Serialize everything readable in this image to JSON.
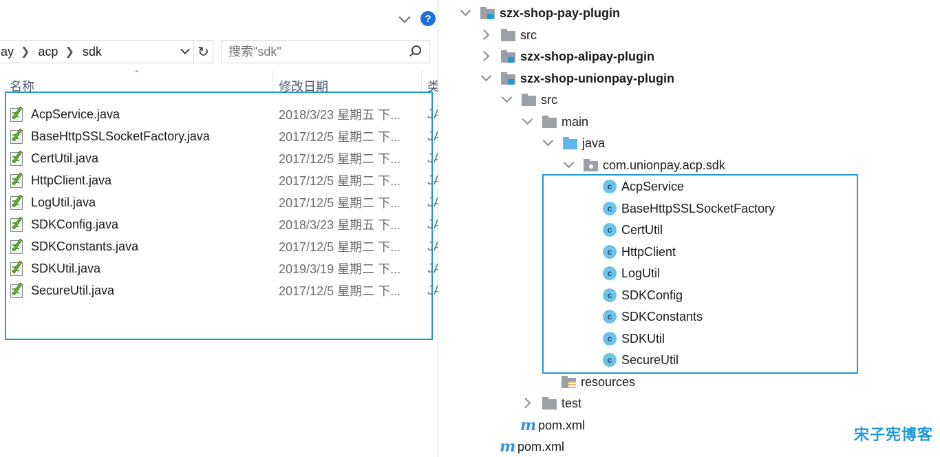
{
  "explorer": {
    "breadcrumb": [
      "ay",
      "acp",
      "sdk"
    ],
    "search_placeholder": "搜索\"sdk\"",
    "columns": {
      "name": "名称",
      "date": "修改日期",
      "type": "类"
    },
    "files": [
      {
        "name": "AcpService.java",
        "date": "2018/3/23 星期五 下...",
        "type": "JA"
      },
      {
        "name": "BaseHttpSSLSocketFactory.java",
        "date": "2017/12/5 星期二 下...",
        "type": "JA"
      },
      {
        "name": "CertUtil.java",
        "date": "2017/12/5 星期二 下...",
        "type": "JA"
      },
      {
        "name": "HttpClient.java",
        "date": "2017/12/5 星期二 下...",
        "type": "JA"
      },
      {
        "name": "LogUtil.java",
        "date": "2017/12/5 星期二 下...",
        "type": "JA"
      },
      {
        "name": "SDKConfig.java",
        "date": "2018/3/23 星期五 下...",
        "type": "JA"
      },
      {
        "name": "SDKConstants.java",
        "date": "2017/12/5 星期二 下...",
        "type": "JA"
      },
      {
        "name": "SDKUtil.java",
        "date": "2019/3/19 星期二 下...",
        "type": "JA"
      },
      {
        "name": "SecureUtil.java",
        "date": "2017/12/5 星期二 下...",
        "type": "JA"
      }
    ]
  },
  "tree": {
    "module_pay": "szx-shop-pay-plugin",
    "pay_src": "src",
    "module_alipay": "szx-shop-alipay-plugin",
    "module_unionpay": "szx-shop-unionpay-plugin",
    "union_src": "src",
    "main": "main",
    "java": "java",
    "package": "com.unionpay.acp.sdk",
    "classes": [
      "AcpService",
      "BaseHttpSSLSocketFactory",
      "CertUtil",
      "HttpClient",
      "LogUtil",
      "SDKConfig",
      "SDKConstants",
      "SDKUtil",
      "SecureUtil"
    ],
    "resources": "resources",
    "test": "test",
    "union_pom": "pom.xml",
    "pay_pom": "pom.xml",
    "class_glyph": "c",
    "maven_glyph": "m"
  },
  "watermark": "宋子宪博客",
  "colors": {
    "accent": "#1e9ad6",
    "help": "#1e6fd9",
    "class_icon": "#6ec4e8"
  }
}
